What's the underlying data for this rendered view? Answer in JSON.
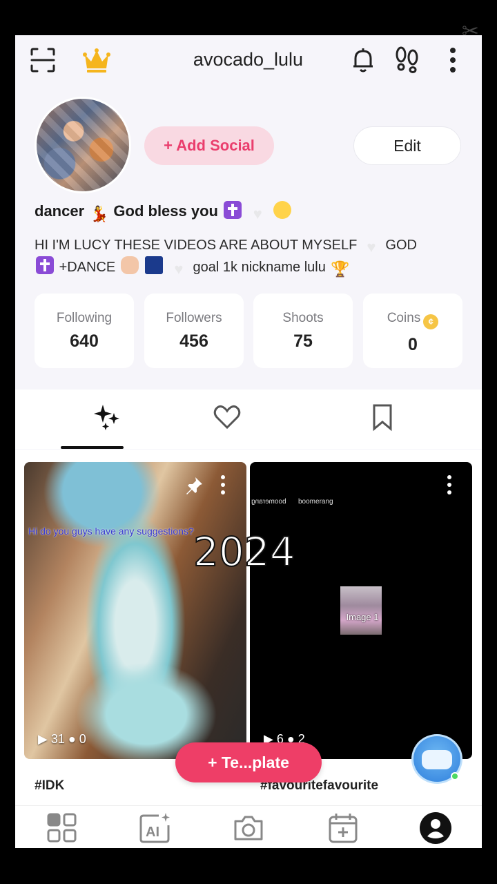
{
  "watermark": "⌘",
  "header": {
    "username": "avocado_lulu",
    "icons": [
      "scan-icon",
      "crown-icon",
      "bell-icon",
      "footprints-icon",
      "more-icon"
    ]
  },
  "profile": {
    "add_social_label": "+ Add Social",
    "edit_label": "Edit",
    "bio_line1_a": "dancer",
    "bio_line1_b": "God bless you",
    "bio_line2_a": "HI I'M LUCY THESE VIDEOS ARE ABOUT MYSELF",
    "bio_line2_b": "GOD",
    "bio_line2_c": "+DANCE",
    "bio_line2_d": "goal 1k nickname lulu"
  },
  "stats": [
    {
      "label": "Following",
      "value": "640"
    },
    {
      "label": "Followers",
      "value": "456"
    },
    {
      "label": "Shoots",
      "value": "75"
    },
    {
      "label": "Coins",
      "value": "0"
    }
  ],
  "tabs": [
    "sparkles-tab",
    "liked-tab",
    "saved-tab"
  ],
  "videos": [
    {
      "caption": "Hi do you guys have any suggestions?",
      "plays": "31",
      "comments": "0",
      "title": "#IDK"
    },
    {
      "boomerang1": "boomerang",
      "boomerang2": "boomerang",
      "image_label": "Image 1",
      "plays": "6",
      "comments": "2",
      "title": "#favouritefavourite"
    }
  ],
  "overlay_text": "2024",
  "template_label": "+ Te...plate",
  "colors": {
    "accent": "#ee3e67",
    "add_social_bg": "#f9d9e2",
    "background": "#f6f5fa"
  }
}
